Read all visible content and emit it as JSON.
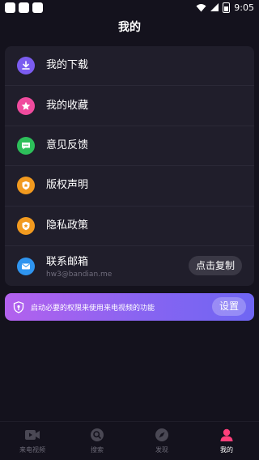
{
  "status_bar": {
    "time": "9:05"
  },
  "header": {
    "title": "我的"
  },
  "menu": {
    "items": [
      {
        "label": "我的下载",
        "icon": "download-icon",
        "color": "#7b5cf0"
      },
      {
        "label": "我的收藏",
        "icon": "star-icon",
        "color": "#f04b9e"
      },
      {
        "label": "意见反馈",
        "icon": "chat-icon",
        "color": "#2dbf5a"
      },
      {
        "label": "版权声明",
        "icon": "shield-star-icon",
        "color": "#f29a1f"
      },
      {
        "label": "隐私政策",
        "icon": "shield-star-icon",
        "color": "#f29a1f"
      },
      {
        "label": "联系邮箱",
        "sub": "hw3@bandian.me",
        "icon": "mail-icon",
        "color": "#2f95f0"
      }
    ],
    "copy_label": "点击复制"
  },
  "permission": {
    "text": "启动必要的权限来使用来电视频的功能",
    "button_label": "设置",
    "gradient_start": "#b361ee",
    "gradient_end": "#6f66f3"
  },
  "tabs": [
    {
      "label": "来电视频",
      "icon": "video-icon",
      "active": false
    },
    {
      "label": "搜索",
      "icon": "search-icon",
      "active": false
    },
    {
      "label": "发现",
      "icon": "compass-icon",
      "active": false
    },
    {
      "label": "我的",
      "icon": "user-icon",
      "active": true
    }
  ],
  "accent_color": "#ff3f7a"
}
